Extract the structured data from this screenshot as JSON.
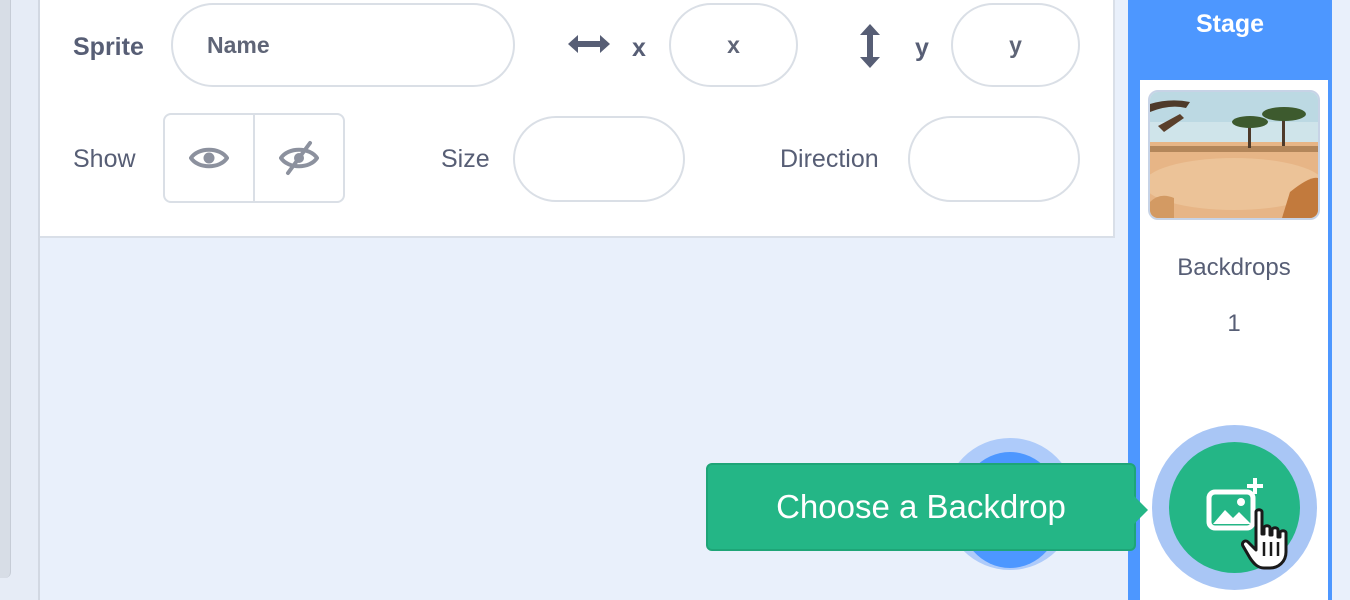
{
  "sprite_info": {
    "sprite_label": "Sprite",
    "name_placeholder": "Name",
    "x_label": "x",
    "x_placeholder": "x",
    "y_label": "y",
    "y_placeholder": "y",
    "show_label": "Show",
    "size_label": "Size",
    "size_value": "",
    "direction_label": "Direction",
    "direction_value": ""
  },
  "stage": {
    "title": "Stage",
    "backdrops_label": "Backdrops",
    "backdrops_count": "1"
  },
  "tooltip": {
    "text": "Choose a Backdrop"
  },
  "icons": {
    "x_axis": "horizontal-arrows-icon",
    "y_axis": "vertical-arrows-icon",
    "show": "eye-icon",
    "hide": "eye-slash-icon",
    "choose_backdrop": "add-image-icon",
    "cursor": "hand-pointer-icon"
  },
  "colors": {
    "stage_blue": "#4d97ff",
    "backdrop_green": "#24b686",
    "text_gray": "#575e75"
  }
}
